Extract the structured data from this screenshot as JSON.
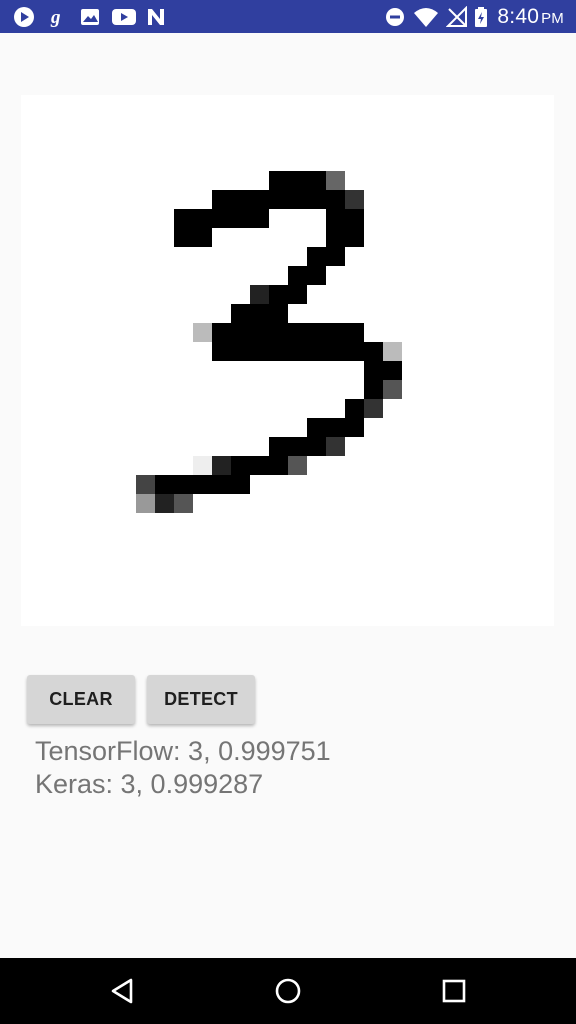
{
  "status_bar": {
    "background": "#303f9f",
    "left_icons": [
      "play-icon",
      "gmail-g-icon",
      "image-icon",
      "youtube-icon",
      "n-news-icon"
    ],
    "right_icons": [
      "dnd-icon",
      "wifi-icon",
      "no-signal-icon",
      "battery-charging-icon"
    ],
    "time": "8:40",
    "ampm": "PM"
  },
  "canvas": {
    "background": "#ffffff",
    "drawn_digit": "3"
  },
  "buttons": {
    "clear_label": "CLEAR",
    "detect_label": "DETECT"
  },
  "results": {
    "tensorflow": "TensorFlow: 3, 0.999751",
    "keras": "Keras: 3, 0.999287"
  },
  "nav_bar": {
    "icons": [
      "back-icon",
      "home-icon",
      "recents-icon"
    ]
  }
}
